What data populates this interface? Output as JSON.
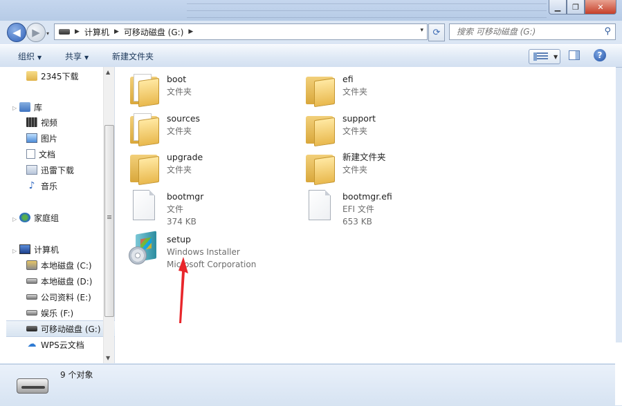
{
  "window": {
    "minimize_label": "▁",
    "maximize_label": "❐",
    "close_label": "✕"
  },
  "nav": {
    "back_label": "◀",
    "forward_label": "▶",
    "dropdown_label": "▾",
    "breadcrumbs": [
      "计算机",
      "可移动磁盘 (G:)"
    ],
    "address_dropdown_label": "▾",
    "refresh_label": "⟳",
    "search_placeholder": "搜索 可移动磁盘 (G:)",
    "search_icon_label": "⚲"
  },
  "toolbar": {
    "organize_label": "组织",
    "share_label": "共享",
    "new_folder_label": "新建文件夹",
    "caret": "▼",
    "help_label": "?"
  },
  "sidebar": {
    "items": [
      {
        "label": "2345下载",
        "icon": "folder-icon"
      },
      {
        "label": "库",
        "icon": "library-icon"
      },
      {
        "label": "视频",
        "icon": "video-icon"
      },
      {
        "label": "图片",
        "icon": "image-icon"
      },
      {
        "label": "文档",
        "icon": "document-icon"
      },
      {
        "label": "迅雷下载",
        "icon": "download-icon"
      },
      {
        "label": "音乐",
        "icon": "music-icon"
      },
      {
        "label": "家庭组",
        "icon": "homegroup-icon"
      },
      {
        "label": "计算机",
        "icon": "computer-icon"
      },
      {
        "label": "本地磁盘 (C:)",
        "icon": "system-drive-icon"
      },
      {
        "label": "本地磁盘 (D:)",
        "icon": "drive-icon"
      },
      {
        "label": "公司资料 (E:)",
        "icon": "drive-icon"
      },
      {
        "label": "娱乐 (F:)",
        "icon": "drive-icon"
      },
      {
        "label": "可移动磁盘 (G:)",
        "icon": "usb-drive-icon"
      },
      {
        "label": "WPS云文档",
        "icon": "cloud-icon"
      }
    ],
    "expand_arrow": "▷",
    "music_glyph": "♪",
    "cloud_glyph": "☁"
  },
  "scrollbar": {
    "up": "▲",
    "down": "▼"
  },
  "files": [
    {
      "name": "boot",
      "lines": [
        "文件夹"
      ],
      "icon": "folder-icon"
    },
    {
      "name": "efi",
      "lines": [
        "文件夹"
      ],
      "icon": "folder-icon"
    },
    {
      "name": "sources",
      "lines": [
        "文件夹"
      ],
      "icon": "folder-icon"
    },
    {
      "name": "support",
      "lines": [
        "文件夹"
      ],
      "icon": "folder-icon"
    },
    {
      "name": "upgrade",
      "lines": [
        "文件夹"
      ],
      "icon": "folder-icon"
    },
    {
      "name": "新建文件夹",
      "lines": [
        "文件夹"
      ],
      "icon": "folder-icon"
    },
    {
      "name": "bootmgr",
      "lines": [
        "文件",
        "374 KB"
      ],
      "icon": "file-icon"
    },
    {
      "name": "bootmgr.efi",
      "lines": [
        "EFI 文件",
        "653 KB"
      ],
      "icon": "file-icon"
    },
    {
      "name": "setup",
      "lines": [
        "Windows Installer",
        "Microsoft Corporation"
      ],
      "icon": "installer-icon"
    }
  ],
  "status": {
    "count_text": "9 个对象"
  },
  "colors": {
    "annotation_arrow": "#e8262b",
    "accent": "#3a6ab4"
  }
}
